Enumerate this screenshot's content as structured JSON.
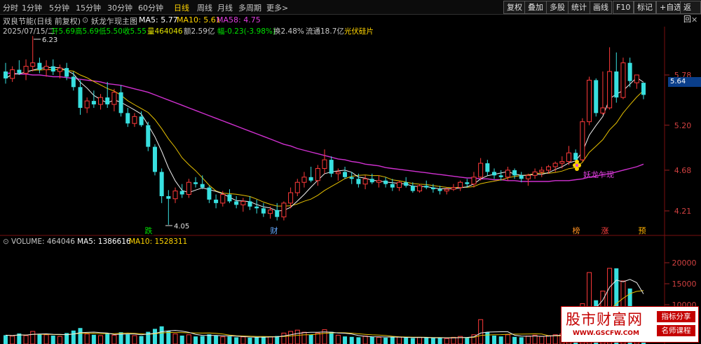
{
  "toolbar": {
    "timeframes": [
      "分时",
      "1分钟",
      "5分钟",
      "15分钟",
      "30分钟",
      "60分钟",
      "日线",
      "周线",
      "月线",
      "多周期",
      "更多>"
    ],
    "active_timeframe": "日线",
    "buttons": [
      "复权",
      "叠加",
      "多股",
      "统计",
      "画线",
      "F10",
      "标记",
      "+自选",
      "返回"
    ]
  },
  "title": {
    "stock": "双良节能(日线 前复权)",
    "indicator": "妖龙乍现主图",
    "ma5": "MA5: 5.77",
    "ma10": "MA10: 5.61",
    "ma58": "MA58: 4.75"
  },
  "info": {
    "date": "2025/07/15/二",
    "open": "开5.69",
    "high": "高5.69",
    "low": "低5.50",
    "close": "收5.55",
    "volume": "量464046",
    "amount": "额2.59亿",
    "change": "幅-0.23(-3.98%)",
    "turnover": "换2.48%",
    "float_cap": "流通18.7亿",
    "sector": "光伏硅片"
  },
  "price_axis": {
    "labels": [
      "5.78",
      "5.20",
      "4.68",
      "4.21"
    ],
    "current": "5.64"
  },
  "annotations": {
    "high": "6.23",
    "low": "4.05",
    "signal": "妖龙乍现",
    "markers": [
      "跌",
      "财",
      "榜",
      "涨",
      "预"
    ]
  },
  "volume_panel": {
    "volume": "VOLUME: 464046",
    "ma5": "MA5: 1386616",
    "ma10": "MA10: 1528311",
    "axis_labels": [
      "20000",
      "15000",
      "10000"
    ]
  },
  "watermark": {
    "title": "股市财富网",
    "url": "WWW.GSCFW.COM",
    "tag1": "指标分享",
    "tag2": "名师课程"
  },
  "chart_data": {
    "type": "candlestick",
    "candles_ohlc": [
      [
        5.82,
        5.92,
        5.68,
        5.74
      ],
      [
        5.74,
        5.88,
        5.7,
        5.84
      ],
      [
        5.84,
        5.95,
        5.78,
        5.8
      ],
      [
        5.8,
        5.96,
        5.72,
        5.88
      ],
      [
        5.88,
        6.23,
        5.82,
        5.92
      ],
      [
        5.92,
        5.98,
        5.8,
        5.84
      ],
      [
        5.84,
        5.95,
        5.76,
        5.88
      ],
      [
        5.88,
        5.96,
        5.78,
        5.82
      ],
      [
        5.82,
        5.9,
        5.74,
        5.86
      ],
      [
        5.86,
        5.92,
        5.72,
        5.76
      ],
      [
        5.76,
        5.82,
        5.6,
        5.64
      ],
      [
        5.64,
        5.72,
        5.32,
        5.4
      ],
      [
        5.4,
        5.52,
        5.34,
        5.48
      ],
      [
        5.48,
        5.6,
        5.4,
        5.44
      ],
      [
        5.44,
        5.56,
        5.38,
        5.52
      ],
      [
        5.52,
        5.7,
        5.4,
        5.44
      ],
      [
        5.44,
        5.62,
        5.36,
        5.58
      ],
      [
        5.58,
        5.66,
        5.3,
        5.34
      ],
      [
        5.34,
        5.4,
        5.18,
        5.22
      ],
      [
        5.22,
        5.34,
        5.18,
        5.3
      ],
      [
        5.3,
        5.36,
        5.18,
        5.2
      ],
      [
        5.2,
        5.24,
        4.9,
        4.95
      ],
      [
        4.95,
        4.98,
        4.62,
        4.66
      ],
      [
        4.66,
        4.7,
        4.3,
        4.38
      ],
      [
        4.38,
        4.45,
        4.05,
        4.35
      ],
      [
        4.35,
        4.48,
        4.3,
        4.44
      ],
      [
        4.44,
        4.52,
        4.36,
        4.4
      ],
      [
        4.4,
        4.58,
        4.36,
        4.54
      ],
      [
        4.54,
        4.6,
        4.48,
        4.52
      ],
      [
        4.52,
        4.62,
        4.46,
        4.48
      ],
      [
        4.48,
        4.5,
        4.3,
        4.34
      ],
      [
        4.34,
        4.4,
        4.24,
        4.3
      ],
      [
        4.3,
        4.44,
        4.26,
        4.4
      ],
      [
        4.4,
        4.46,
        4.3,
        4.32
      ],
      [
        4.32,
        4.38,
        4.24,
        4.28
      ],
      [
        4.28,
        4.36,
        4.2,
        4.32
      ],
      [
        4.32,
        4.38,
        4.22,
        4.26
      ],
      [
        4.26,
        4.34,
        4.18,
        4.24
      ],
      [
        4.24,
        4.3,
        4.14,
        4.18
      ],
      [
        4.18,
        4.26,
        4.12,
        4.22
      ],
      [
        4.22,
        4.3,
        4.1,
        4.14
      ],
      [
        4.14,
        4.32,
        4.1,
        4.3
      ],
      [
        4.3,
        4.48,
        4.24,
        4.42
      ],
      [
        4.42,
        4.58,
        4.38,
        4.54
      ],
      [
        4.54,
        4.66,
        4.48,
        4.6
      ],
      [
        4.6,
        4.72,
        4.54,
        4.56
      ],
      [
        4.56,
        4.74,
        4.5,
        4.7
      ],
      [
        4.7,
        4.92,
        4.64,
        4.8
      ],
      [
        4.8,
        4.84,
        4.6,
        4.64
      ],
      [
        4.64,
        4.7,
        4.56,
        4.66
      ],
      [
        4.66,
        4.72,
        4.58,
        4.6
      ],
      [
        4.6,
        4.66,
        4.52,
        4.58
      ],
      [
        4.58,
        4.64,
        4.48,
        4.52
      ],
      [
        4.52,
        4.62,
        4.46,
        4.58
      ],
      [
        4.58,
        4.64,
        4.52,
        4.54
      ],
      [
        4.54,
        4.62,
        4.48,
        4.56
      ],
      [
        4.56,
        4.6,
        4.48,
        4.52
      ],
      [
        4.52,
        4.58,
        4.44,
        4.48
      ],
      [
        4.48,
        4.56,
        4.44,
        4.54
      ],
      [
        4.54,
        4.6,
        4.48,
        4.5
      ],
      [
        4.5,
        4.54,
        4.42,
        4.44
      ],
      [
        4.44,
        4.52,
        4.42,
        4.5
      ],
      [
        4.5,
        4.56,
        4.46,
        4.48
      ],
      [
        4.48,
        4.52,
        4.42,
        4.46
      ],
      [
        4.46,
        4.5,
        4.4,
        4.44
      ],
      [
        4.44,
        4.48,
        4.4,
        4.46
      ],
      [
        4.46,
        4.52,
        4.44,
        4.48
      ],
      [
        4.48,
        4.56,
        4.44,
        4.54
      ],
      [
        4.54,
        4.58,
        4.48,
        4.52
      ],
      [
        4.52,
        4.66,
        4.48,
        4.6
      ],
      [
        4.6,
        4.82,
        4.56,
        4.76
      ],
      [
        4.76,
        4.8,
        4.62,
        4.66
      ],
      [
        4.66,
        4.7,
        4.58,
        4.62
      ],
      [
        4.62,
        4.68,
        4.56,
        4.6
      ],
      [
        4.6,
        4.72,
        4.56,
        4.68
      ],
      [
        4.68,
        4.7,
        4.58,
        4.62
      ],
      [
        4.62,
        4.66,
        4.54,
        4.58
      ],
      [
        4.58,
        4.64,
        4.5,
        4.62
      ],
      [
        4.62,
        4.7,
        4.58,
        4.66
      ],
      [
        4.66,
        4.72,
        4.6,
        4.68
      ],
      [
        4.68,
        4.74,
        4.64,
        4.72
      ],
      [
        4.72,
        4.78,
        4.66,
        4.76
      ],
      [
        4.76,
        4.84,
        4.7,
        4.78
      ],
      [
        4.78,
        4.96,
        4.74,
        4.88
      ],
      [
        4.88,
        4.92,
        4.74,
        4.8
      ],
      [
        4.8,
        5.28,
        4.78,
        5.24
      ],
      [
        5.24,
        5.76,
        5.2,
        5.72
      ],
      [
        5.72,
        5.74,
        5.3,
        5.34
      ],
      [
        5.34,
        5.82,
        5.32,
        5.4
      ],
      [
        5.4,
        6.1,
        5.38,
        5.82
      ],
      [
        5.82,
        6.04,
        5.46,
        5.52
      ],
      [
        5.52,
        5.98,
        5.5,
        5.92
      ],
      [
        5.92,
        5.98,
        5.64,
        5.71
      ],
      [
        5.69,
        5.72,
        5.62,
        5.78
      ],
      [
        5.69,
        5.69,
        5.5,
        5.55
      ]
    ],
    "volume": [
      2.1,
      1.9,
      2.5,
      2.0,
      3.0,
      2.4,
      2.2,
      2.0,
      1.8,
      2.6,
      3.2,
      3.8,
      2.4,
      2.2,
      2.0,
      2.6,
      2.1,
      2.8,
      2.3,
      2.0,
      1.9,
      2.9,
      3.6,
      4.2,
      3.1,
      2.4,
      2.0,
      2.2,
      1.8,
      1.9,
      2.3,
      2.0,
      1.7,
      1.8,
      1.6,
      1.7,
      1.5,
      1.6,
      1.8,
      1.7,
      1.9,
      2.6,
      3.0,
      3.3,
      2.8,
      2.2,
      2.6,
      3.4,
      2.9,
      2.1,
      1.8,
      1.7,
      1.6,
      1.9,
      1.7,
      1.6,
      1.5,
      1.6,
      1.7,
      1.5,
      1.4,
      1.6,
      1.5,
      1.4,
      1.5,
      1.3,
      1.6,
      1.8,
      1.6,
      2.2,
      5.8,
      2.8,
      2.0,
      1.8,
      2.2,
      1.7,
      1.6,
      1.9,
      2.1,
      1.8,
      2.0,
      2.2,
      2.4,
      3.2,
      2.6,
      9.6,
      17.0,
      10.4,
      12.6,
      18.0,
      18.0,
      15.0,
      13.2,
      8.8,
      4.6
    ],
    "ma58": [
      5.8,
      5.8,
      5.79,
      5.79,
      5.78,
      5.78,
      5.77,
      5.76,
      5.76,
      5.75,
      5.74,
      5.73,
      5.72,
      5.71,
      5.7,
      5.68,
      5.67,
      5.66,
      5.64,
      5.62,
      5.6,
      5.58,
      5.55,
      5.52,
      5.49,
      5.46,
      5.43,
      5.4,
      5.37,
      5.34,
      5.31,
      5.28,
      5.25,
      5.22,
      5.19,
      5.16,
      5.13,
      5.1,
      5.07,
      5.04,
      5.01,
      4.98,
      4.96,
      4.93,
      4.91,
      4.89,
      4.87,
      4.85,
      4.83,
      4.81,
      4.8,
      4.78,
      4.77,
      4.75,
      4.74,
      4.73,
      4.71,
      4.7,
      4.69,
      4.68,
      4.67,
      4.66,
      4.65,
      4.64,
      4.63,
      4.62,
      4.61,
      4.6,
      4.59,
      4.59,
      4.58,
      4.58,
      4.57,
      4.57,
      4.56,
      4.56,
      4.55,
      4.55,
      4.55,
      4.55,
      4.55,
      4.56,
      4.56,
      4.56,
      4.57,
      4.58,
      4.6,
      4.61,
      4.63,
      4.64,
      4.66,
      4.68,
      4.7,
      4.72,
      4.75
    ]
  }
}
